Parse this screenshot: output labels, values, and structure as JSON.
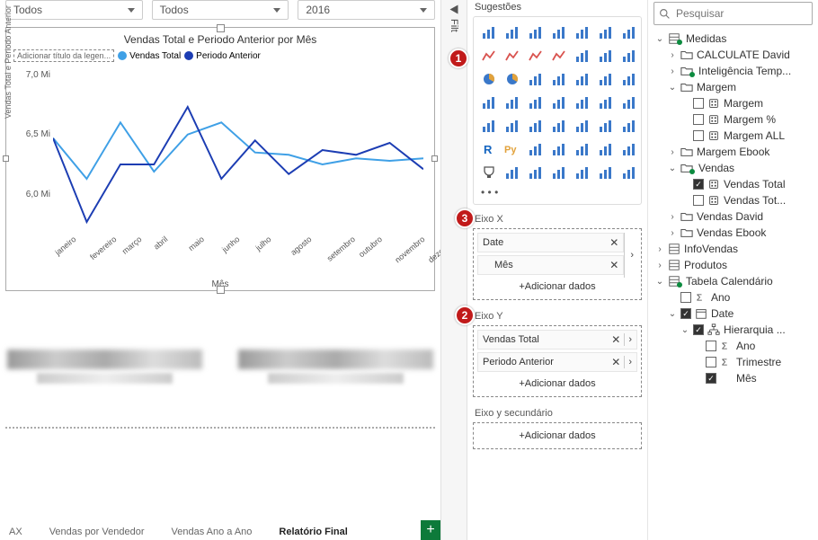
{
  "filters": {
    "f1": "Todos",
    "f2": "Todos",
    "f3": "2016"
  },
  "chart": {
    "title": "Vendas Total e Periodo Anterior por Mês",
    "legend_placeholder": "Adicionar título da legen...",
    "series1_name": "Vendas Total",
    "series2_name": "Periodo Anterior",
    "ylabel": "Vendas Total e Periodo Anterior",
    "xlabel": "Mês",
    "yticks": [
      "7,0 Mi",
      "6,5 Mi",
      "6,0 Mi"
    ],
    "xticks": [
      "janeiro",
      "fevereiro",
      "março",
      "abril",
      "maio",
      "junho",
      "julho",
      "agosto",
      "setembro",
      "outubro",
      "novembro",
      "dezembro"
    ]
  },
  "chart_data": {
    "type": "line",
    "x": [
      "janeiro",
      "fevereiro",
      "março",
      "abril",
      "maio",
      "junho",
      "julho",
      "agosto",
      "setembro",
      "outubro",
      "novembro",
      "dezembro"
    ],
    "series": [
      {
        "name": "Vendas Total",
        "color": "#3fa0e6",
        "values": [
          6.52,
          6.18,
          6.65,
          6.24,
          6.55,
          6.65,
          6.4,
          6.38,
          6.3,
          6.35,
          6.33,
          6.35
        ]
      },
      {
        "name": "Periodo Anterior",
        "color": "#1c3db3",
        "values": [
          6.52,
          5.82,
          6.3,
          6.3,
          6.78,
          6.18,
          6.5,
          6.22,
          6.42,
          6.38,
          6.48,
          6.26
        ]
      }
    ],
    "ylim": [
      5.7,
      7.05
    ],
    "title": "Vendas Total e Periodo Anterior por Mês",
    "xlabel": "Mês",
    "ylabel": "Vendas Total e Periodo Anterior"
  },
  "tabs": {
    "t1": "AX",
    "t2": "Vendas por Vendedor",
    "t3": "Vendas Ano a Ano",
    "t4": "Relatório Final"
  },
  "filt_strip": "Filt",
  "viz": {
    "section": "Sugestões",
    "wells": {
      "x_label": "Eixo X",
      "x_f1": "Date",
      "x_f2": "Mês",
      "y_label": "Eixo Y",
      "y_f1": "Vendas Total",
      "y_f2": "Periodo Anterior",
      "y2_label": "Eixo y secundário",
      "add": "+Adicionar dados"
    }
  },
  "fields": {
    "search_ph": "Pesquisar",
    "medidas": "Medidas",
    "calc_david": "CALCULATE David",
    "intel_temp": "Inteligência Temp...",
    "margem_grp": "Margem",
    "margem": "Margem",
    "margem_pct": "Margem %",
    "margem_all": "Margem ALL",
    "margem_ebook": "Margem Ebook",
    "vendas_grp": "Vendas",
    "vendas_total": "Vendas Total",
    "vendas_tot2": "Vendas Tot...",
    "vendas_david": "Vendas David",
    "vendas_ebook": "Vendas Ebook",
    "infovendas": "InfoVendas",
    "produtos": "Produtos",
    "tabcal": "Tabela Calendário",
    "ano": "Ano",
    "date": "Date",
    "hier": "Hierarquia ...",
    "h_ano": "Ano",
    "h_tri": "Trimestre",
    "h_mes": "Mês"
  }
}
